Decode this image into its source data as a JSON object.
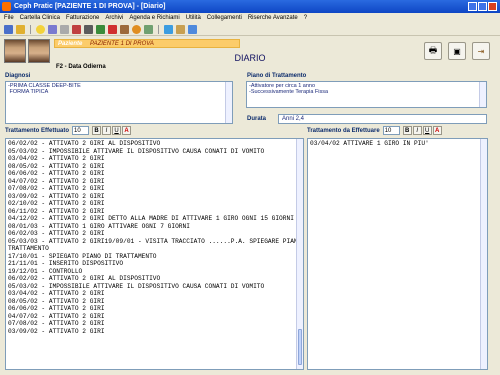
{
  "window": {
    "title": "Ceph Pratic [PAZIENTE 1 DI PROVA]  - [Diario]"
  },
  "menu": [
    "File",
    "Cartella Clinica",
    "Fatturazione",
    "Archivi",
    "Agenda e Richiami",
    "Utilità",
    "Collegamenti",
    "Riserche Avanzate",
    "?"
  ],
  "patient": {
    "label": "Paziente",
    "name": "PAZIENTE 1 DI PROVA",
    "date_label": "F2 - Data Odierna"
  },
  "page_title": "DIARIO",
  "diagnosis": {
    "label": "Diagnosi",
    "text": "-PRIMA CLASSE DEEP-BITE\n FORMA TIPICA"
  },
  "plan": {
    "label": "Piano di Trattamento",
    "text": "-Attivatore per circa 1 anno\n-Successivamente Terapia Fissa"
  },
  "duration": {
    "label": "Durata",
    "value": "Anni 2,4"
  },
  "treatment_done": {
    "label": "Trattamento Effettuato",
    "font_size": "10",
    "lines": [
      "06/02/02 - ATTIVATO 2 GIRI AL DISPOSITIVO",
      "05/03/02 - IMPOSSIBILE ATTIVARE IL DISPOSITIVO CAUSA CONATI DI VOMITO",
      "03/04/02 - ATTIVATO 2 GIRI",
      "08/05/02 - ATTIVATO 2 GIRI",
      "06/06/02 - ATTIVATO 2 GIRI",
      "04/07/02 - ATTIVATO 2 GIRI",
      "07/08/02 - ATTIVATO 2 GIRI",
      "03/09/02 - ATTIVATO 2 GIRI",
      "02/10/02 - ATTIVATO 2 GIRI",
      "06/11/02 - ATTIVATO 2 GIRI",
      "04/12/02 - ATTIVATO 2 GIRI  DETTO ALLA MADRE DI ATTIVARE 1 GIRO OGNI 15 GIORNI",
      "08/01/03 - ATTIVATO 1 GIRO   ATTIVARE OGNI 7 GIORNI",
      "06/02/03 - ATTIVATO 2 GIRI",
      "05/03/03 - ATTIVATO 2 GIRI19/09/01 - VISITA   TRACCIATO ......P.A. SPIEGARE PIANO DI",
      "TRATTAMENTO",
      "17/10/01 - SPIEGATO PIANO DI TRATTAMENTO",
      "21/11/01 - INSERITO DISPOSITIVO",
      "19/12/01 - CONTROLLO",
      "06/02/02 - ATTIVATO 2 GIRI AL DISPOSITIVO",
      "05/03/02 - IMPOSSIBILE ATTIVARE IL DISPOSITIVO CAUSA CONATI DI VOMITO",
      "03/04/02 - ATTIVATO 2 GIRI",
      "08/05/02 - ATTIVATO 2 GIRI",
      "06/06/02 - ATTIVATO 2 GIRI",
      "04/07/02 - ATTIVATO 2 GIRI",
      "07/08/02 - ATTIVATO 2 GIRI",
      "03/09/02 - ATTIVATO 2 GIRI"
    ]
  },
  "treatment_todo": {
    "label": "Trattamento da Effettuare",
    "font_size": "10",
    "lines": [
      "03/04/02 ATTIVARE 1 GIRO IN PIU'"
    ]
  },
  "format_buttons": {
    "bold": "B",
    "italic": "I",
    "underline": "U",
    "color": "A"
  }
}
